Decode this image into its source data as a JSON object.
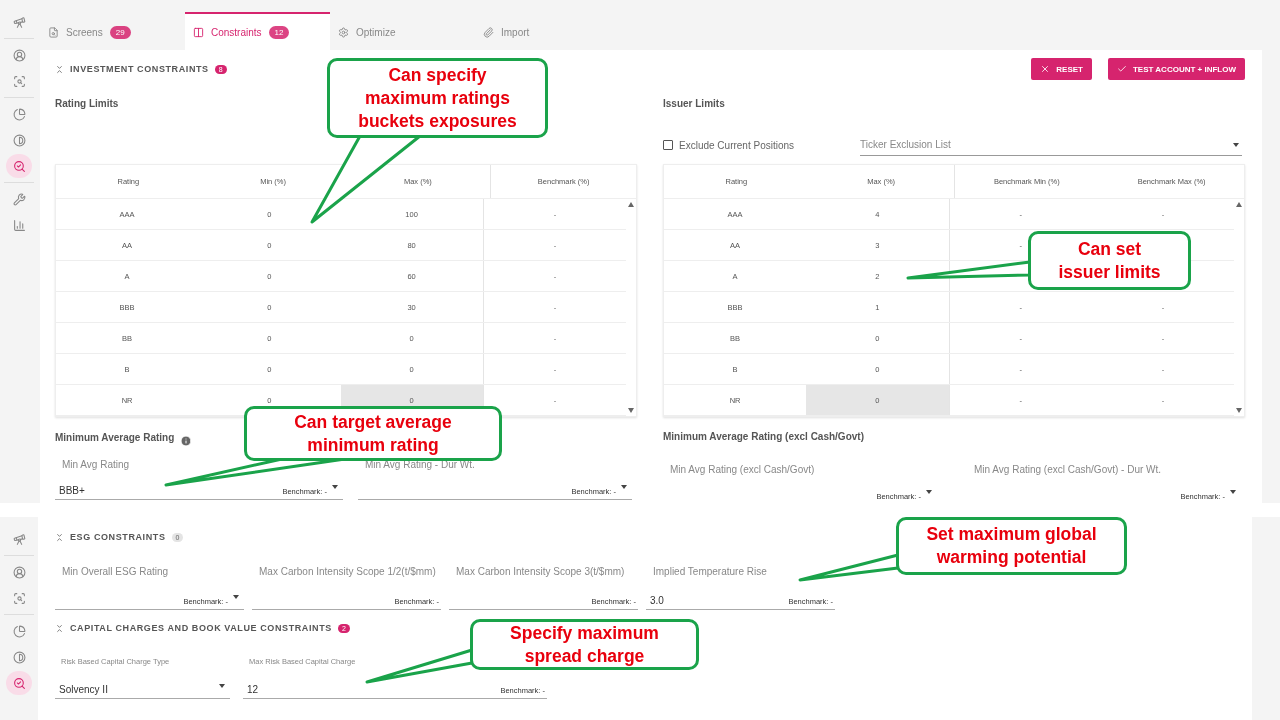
{
  "top": {
    "sidebar": [
      {
        "selected": false
      },
      {
        "selected": false
      },
      {
        "selected": false
      },
      {
        "selected": false
      },
      {
        "selected": false
      },
      {
        "selected": true
      },
      {
        "selected": false
      },
      {
        "selected": false
      }
    ],
    "tabs": [
      {
        "label": "Screens",
        "count": "29",
        "selected": false
      },
      {
        "label": "Constraints",
        "count": "12",
        "selected": true
      },
      {
        "label": "Optimize",
        "selected": false
      },
      {
        "label": "Import",
        "selected": false
      }
    ],
    "section": {
      "title": "INVESTMENT CONSTRAINTS",
      "count": "8",
      "badge_active": true
    },
    "buttons": [
      {
        "label": "RESET",
        "kind": "reset"
      },
      {
        "label": "TEST ACCOUNT + INFLOW",
        "kind": "confirm"
      }
    ],
    "rating_limits": {
      "title": "Rating Limits",
      "columns": [
        "Rating",
        "Min (%)",
        "Max (%)",
        "Benchmark (%)"
      ],
      "rows": [
        {
          "cells": [
            "AAA",
            "0",
            "100",
            "-"
          ],
          "max_disabled": false
        },
        {
          "cells": [
            "AA",
            "0",
            "80",
            "-"
          ],
          "max_disabled": false
        },
        {
          "cells": [
            "A",
            "0",
            "60",
            "-"
          ],
          "max_disabled": false
        },
        {
          "cells": [
            "BBB",
            "0",
            "30",
            "-"
          ],
          "max_disabled": false
        },
        {
          "cells": [
            "BB",
            "0",
            "0",
            "-"
          ],
          "max_disabled": false
        },
        {
          "cells": [
            "B",
            "0",
            "0",
            "-"
          ],
          "max_disabled": false
        },
        {
          "cells": [
            "NR",
            "0",
            "0",
            "-"
          ],
          "max_disabled": true
        }
      ]
    },
    "issuer_limits": {
      "title": "Issuer Limits",
      "exclude_current_positions": {
        "label": "Exclude Current Positions",
        "checked": false
      },
      "ticker_exclusion": {
        "placeholder": "Ticker Exclusion List"
      },
      "columns": [
        "Rating",
        "Max (%)",
        "Benchmark Min (%)",
        "Benchmark Max (%)"
      ],
      "rows": [
        {
          "cells": [
            "AAA",
            "4",
            "-",
            "-"
          ],
          "max_disabled": false
        },
        {
          "cells": [
            "AA",
            "3",
            "-",
            null
          ],
          "max_disabled": false
        },
        {
          "cells": [
            "A",
            "2",
            null,
            null
          ],
          "max_disabled": false
        },
        {
          "cells": [
            "BBB",
            "1",
            "-",
            "-"
          ],
          "max_disabled": false
        },
        {
          "cells": [
            "BB",
            "0",
            "-",
            "-"
          ],
          "max_disabled": false
        },
        {
          "cells": [
            "B",
            "0",
            "-",
            "-"
          ],
          "max_disabled": false
        },
        {
          "cells": [
            "NR",
            "0",
            "-",
            "-"
          ],
          "max_disabled": true
        }
      ]
    },
    "min_avg_rating": {
      "title": "Minimum Average Rating",
      "fields": [
        {
          "label": "Min Avg Rating",
          "value": "BBB+",
          "benchmark": "Benchmark: -",
          "dropdown": true
        },
        {
          "label": "Min Avg Rating - Dur Wt.",
          "benchmark": "Benchmark: -",
          "dropdown": true
        }
      ]
    },
    "min_avg_rating_excl": {
      "title": "Minimum Average Rating (excl Cash/Govt)",
      "fields": [
        {
          "label": "Min Avg Rating (excl Cash/Govt)",
          "benchmark": "Benchmark: -",
          "dropdown": true
        },
        {
          "label": "Min Avg Rating (excl Cash/Govt) - Dur Wt.",
          "benchmark": "Benchmark: -",
          "dropdown": true
        }
      ]
    }
  },
  "bottom": {
    "sidebar": [
      {
        "selected": false
      },
      {
        "selected": false
      },
      {
        "selected": false
      },
      {
        "selected": false
      },
      {
        "selected": false
      },
      {
        "selected": true
      }
    ],
    "sections": [
      {
        "title": "ESG CONSTRAINTS",
        "count": "0",
        "badge_active": false,
        "fields": [
          {
            "label": "Min Overall ESG Rating",
            "benchmark": "Benchmark: -",
            "dropdown": true
          },
          {
            "label": "Max Carbon Intensity Scope 1/2(t/$mm)",
            "benchmark": "Benchmark: -",
            "dropdown": false
          },
          {
            "label": "Max Carbon Intensity Scope 3(t/$mm)",
            "benchmark": "Benchmark: -",
            "dropdown": false
          },
          {
            "label": "Implied Temperature Rise",
            "value": "3.0",
            "benchmark": "Benchmark: -",
            "dropdown": false
          }
        ]
      },
      {
        "title": "CAPITAL CHARGES AND BOOK VALUE CONSTRAINTS",
        "count": "2",
        "badge_active": true,
        "fields": [
          {
            "label": "Risk Based Capital Charge Type",
            "value": "Solvency II",
            "dropdown": true
          },
          {
            "label": "Max Risk Based Capital Charge",
            "value": "12",
            "benchmark": "Benchmark: -",
            "dropdown": false
          }
        ]
      }
    ]
  },
  "annotations": [
    {
      "lines": [
        "Can specify",
        "maximum ratings",
        "buckets exposures"
      ]
    },
    {
      "lines": [
        "Can set",
        "issuer limits"
      ]
    },
    {
      "lines": [
        "Can target average",
        "minimum rating"
      ]
    },
    {
      "lines": [
        "Set maximum global",
        "warming potential"
      ]
    },
    {
      "lines": [
        "Specify maximum",
        "spread charge"
      ]
    }
  ]
}
